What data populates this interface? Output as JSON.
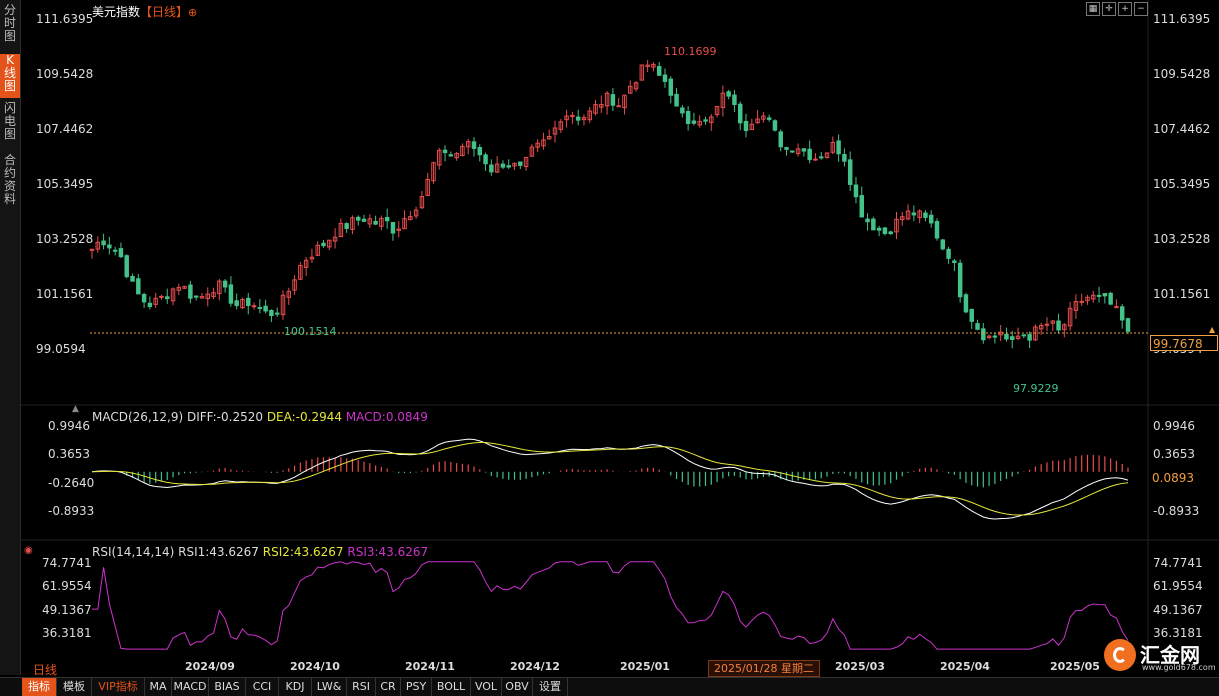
{
  "title": "美元指数",
  "period_tag": "【日线】",
  "period_tag_icon": "plus-circle-icon",
  "left_tabs": [
    {
      "label": "分时图",
      "active": false
    },
    {
      "label": "K线图",
      "active": true
    },
    {
      "label": "闪电图",
      "active": false
    },
    {
      "label": "合约资料",
      "active": false
    }
  ],
  "toolbar_buttons": [
    "grid-icon",
    "crosshair-icon",
    "zoom-in-icon",
    "zoom-out-icon"
  ],
  "price_axis": {
    "left_labels": [
      "111.6395",
      "109.5428",
      "107.4462",
      "105.3495",
      "103.2528",
      "101.1561",
      "99.0594"
    ],
    "right_labels": [
      "111.6395",
      "109.5428",
      "107.4462",
      "105.3495",
      "103.2528",
      "101.1561",
      "99.0594"
    ]
  },
  "annotations": {
    "high": "110.1699",
    "low": "97.9229",
    "mid_low": "100.1514"
  },
  "current_price": "99.7678",
  "macd": {
    "title": "MACD(26,12,9)",
    "diff_label": "DIFF:-0.2520",
    "dea_label": "DEA:-0.2944",
    "macd_label": "MACD:0.0849",
    "axis_labels": [
      "0.9946",
      "0.3653",
      "-0.2640",
      "-0.8933"
    ],
    "current": "0.0893"
  },
  "rsi": {
    "title": "RSI(14,14,14)",
    "rsi1_label": "RSI1:43.6267",
    "rsi2_label": "RSI2:43.6267",
    "rsi3_label": "RSI3:43.6267",
    "axis_labels": [
      "74.7741",
      "61.9554",
      "49.1367",
      "36.3181"
    ]
  },
  "date_axis": [
    "2024/09",
    "2024/10",
    "2024/11",
    "2024/12",
    "2025/01",
    "2025/03",
    "2025/04",
    "2025/05"
  ],
  "cursor_date": "2025/01/28 星期二",
  "period_label": "日线",
  "bottom_tabs": [
    {
      "label": "指标",
      "active": true
    },
    {
      "label": "模板"
    },
    {
      "label": "VIP指标",
      "vip": true
    },
    {
      "label": "MA"
    },
    {
      "label": "MACD"
    },
    {
      "label": "BIAS"
    },
    {
      "label": "CCI"
    },
    {
      "label": "KDJ"
    },
    {
      "label": "LW&"
    },
    {
      "label": "RSI"
    },
    {
      "label": "CR"
    },
    {
      "label": "PSY"
    },
    {
      "label": "BOLL"
    },
    {
      "label": "VOL"
    },
    {
      "label": "OBV"
    },
    {
      "label": "设置"
    }
  ],
  "logo": {
    "text": "汇金网",
    "url": "www.gold678.com"
  },
  "colors": {
    "up": "#e84d4d",
    "down": "#43c28a",
    "diff": "#ffffff",
    "dea": "#e6e63a",
    "macd": "#cc33cc",
    "rsi": "#cc33cc",
    "accent": "#e4541a",
    "price_line": "#f0a040"
  },
  "chart_data": {
    "type": "candlestick",
    "title": "美元指数",
    "y_range": [
      97.5,
      111.8
    ],
    "anchor_closes": [
      102.9,
      103.3,
      103.0,
      102.6,
      101.6,
      101.0,
      100.8,
      101.0,
      101.3,
      101.6,
      101.2,
      101.0,
      101.4,
      101.5,
      101.1,
      100.7,
      100.9,
      100.7,
      100.4,
      100.6,
      101.2,
      102.1,
      102.6,
      102.9,
      103.2,
      103.6,
      103.8,
      104.0,
      104.1,
      103.9,
      104.0,
      103.6,
      104.1,
      104.5,
      105.1,
      106.2,
      106.7,
      106.4,
      106.9,
      106.8,
      106.4,
      105.9,
      106.2,
      106.1,
      105.9,
      106.6,
      106.9,
      107.2,
      108.0,
      108.1,
      107.9,
      108.1,
      108.5,
      108.7,
      108.4,
      109.1,
      109.6,
      110.0,
      109.5,
      109.2,
      108.0,
      107.8,
      108.0,
      107.6,
      108.3,
      109.0,
      108.0,
      107.6,
      108.1,
      107.9,
      107.2,
      106.7,
      106.9,
      106.6,
      106.4,
      106.6,
      106.9,
      106.4,
      105.0,
      104.1,
      103.8,
      103.5,
      103.8,
      104.2,
      104.3,
      104.1,
      103.8,
      103.0,
      102.6,
      101.0,
      100.3,
      99.7,
      99.5,
      99.8,
      99.2,
      99.7,
      99.6,
      99.9,
      100.1,
      99.7,
      100.4,
      100.9,
      101.1,
      101.0,
      100.9,
      100.4,
      99.77
    ],
    "highs_lows": {
      "high": 110.1699,
      "low": 97.9229,
      "mid_low": 100.1514
    }
  }
}
